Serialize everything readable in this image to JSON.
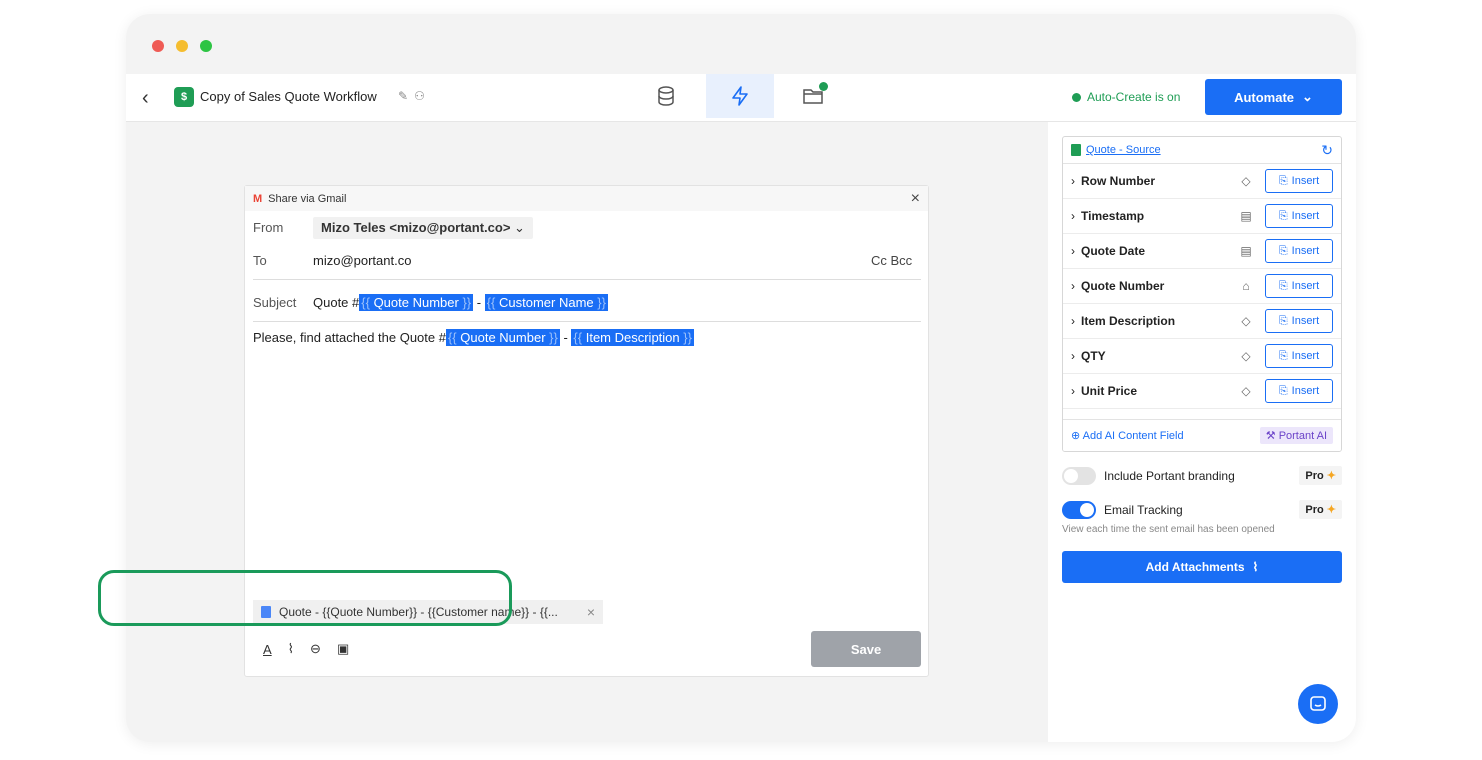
{
  "window": {
    "dots": [
      "#ef5b55",
      "#f5bd2f",
      "#2dc443"
    ]
  },
  "topbar": {
    "app_icon": "$",
    "title": "Copy of Sales Quote Workflow",
    "tabs": [
      {
        "name": "database-icon",
        "active": false
      },
      {
        "name": "lightning-icon",
        "active": true
      },
      {
        "name": "folder-icon",
        "active": false
      }
    ],
    "auto_create": "Auto-Create is on",
    "automate_label": "Automate"
  },
  "gmail": {
    "header": "Share via Gmail",
    "from_label": "From",
    "from_value": "Mizo Teles <mizo@portant.co>",
    "to_label": "To",
    "to_value": "mizo@portant.co",
    "cc": "Cc",
    "bcc": "Bcc",
    "subject_label": "Subject",
    "subject_prefix": "Quote #",
    "subject_tag1": "Quote Number",
    "subject_sep": "-",
    "subject_tag2": "Customer Name",
    "body_prefix": "Please, find attached the Quote #",
    "body_tag1": "Quote Number",
    "body_sep": "-",
    "body_tag2": "Item Description",
    "attachment": "Quote - {{Quote Number}} - {{Customer name}} - {{...",
    "save_label": "Save"
  },
  "source": {
    "title": "Quote - Source",
    "insert_label": "Insert",
    "fields": [
      {
        "label": "Row Number",
        "icon": "tag-icon"
      },
      {
        "label": "Timestamp",
        "icon": "calendar-icon"
      },
      {
        "label": "Quote Date",
        "icon": "calendar-icon"
      },
      {
        "label": "Quote Number",
        "icon": "lock-icon"
      },
      {
        "label": "Item Description",
        "icon": "tag-icon"
      },
      {
        "label": "QTY",
        "icon": "tag-icon"
      },
      {
        "label": "Unit Price",
        "icon": "tag-icon"
      }
    ],
    "add_ai": "Add AI Content Field",
    "ai_badge": "Portant AI"
  },
  "settings": {
    "branding_label": "Include Portant branding",
    "branding_on": false,
    "tracking_label": "Email Tracking",
    "tracking_on": true,
    "tracking_hint": "View each time the sent email has been opened",
    "pro_label": "Pro",
    "attachments_label": "Add Attachments"
  },
  "colors": {
    "accent": "#1a6ef5",
    "success": "#1f9d55",
    "highlight": "#1a9a5a"
  }
}
